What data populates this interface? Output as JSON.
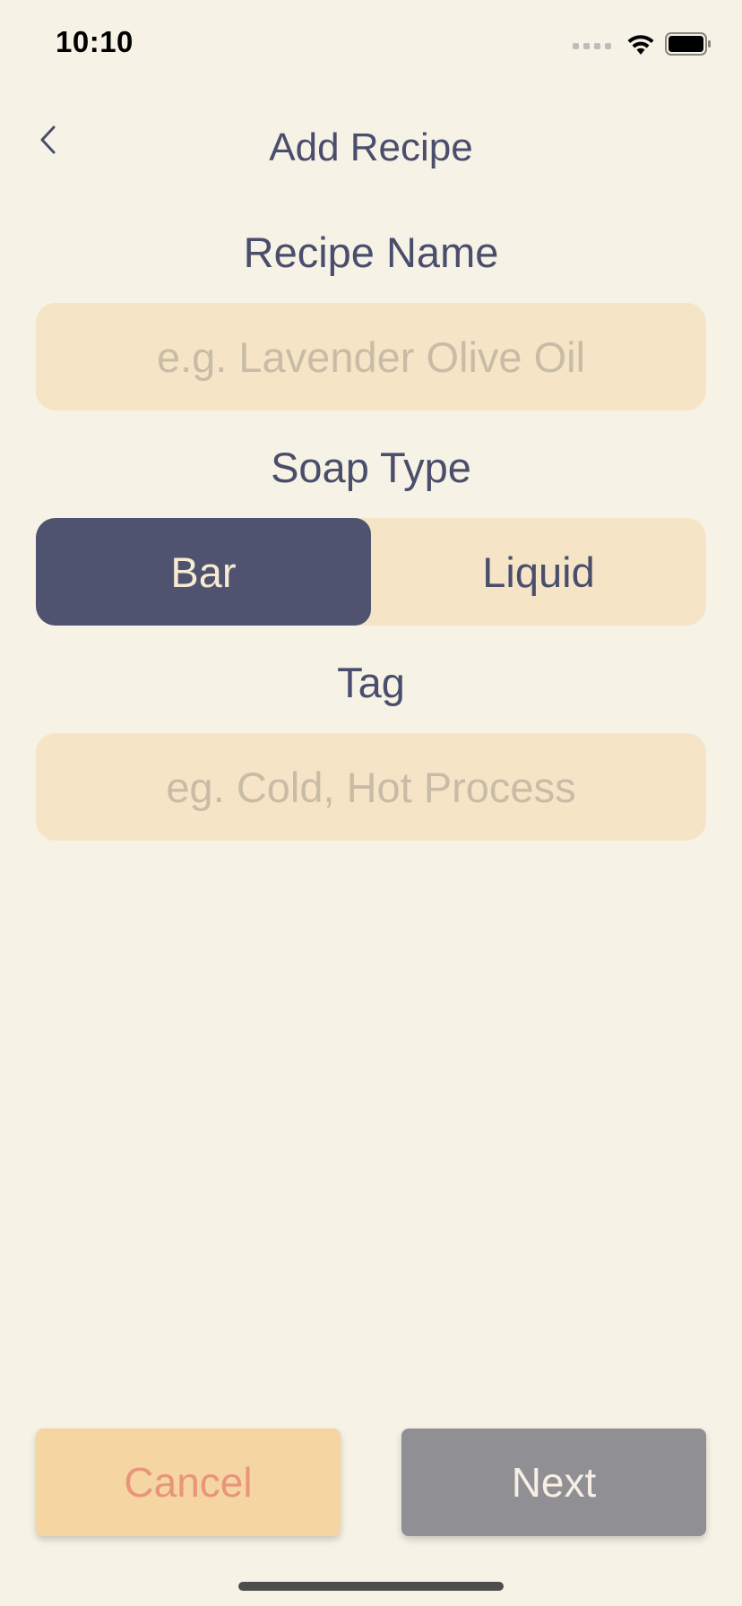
{
  "status_bar": {
    "time": "10:10"
  },
  "nav": {
    "title": "Add Recipe",
    "back_icon": "chevron-left-icon"
  },
  "recipe_name": {
    "label": "Recipe Name",
    "value": "",
    "placeholder": "e.g. Lavender Olive Oil"
  },
  "soap_type": {
    "label": "Soap Type",
    "options": [
      "Bar",
      "Liquid"
    ],
    "selected": "Bar"
  },
  "tag": {
    "label": "Tag",
    "value": "",
    "placeholder": "eg. Cold, Hot Process"
  },
  "actions": {
    "cancel_label": "Cancel",
    "next_label": "Next"
  },
  "colors": {
    "background": "#F6F2E6",
    "field_fill": "#F5E5C6",
    "accent_dark": "#50536F",
    "text_primary": "#4A4E6C",
    "cancel_fill": "#F5D5A1",
    "cancel_text": "#E8957B",
    "next_fill": "#8F8F94"
  }
}
